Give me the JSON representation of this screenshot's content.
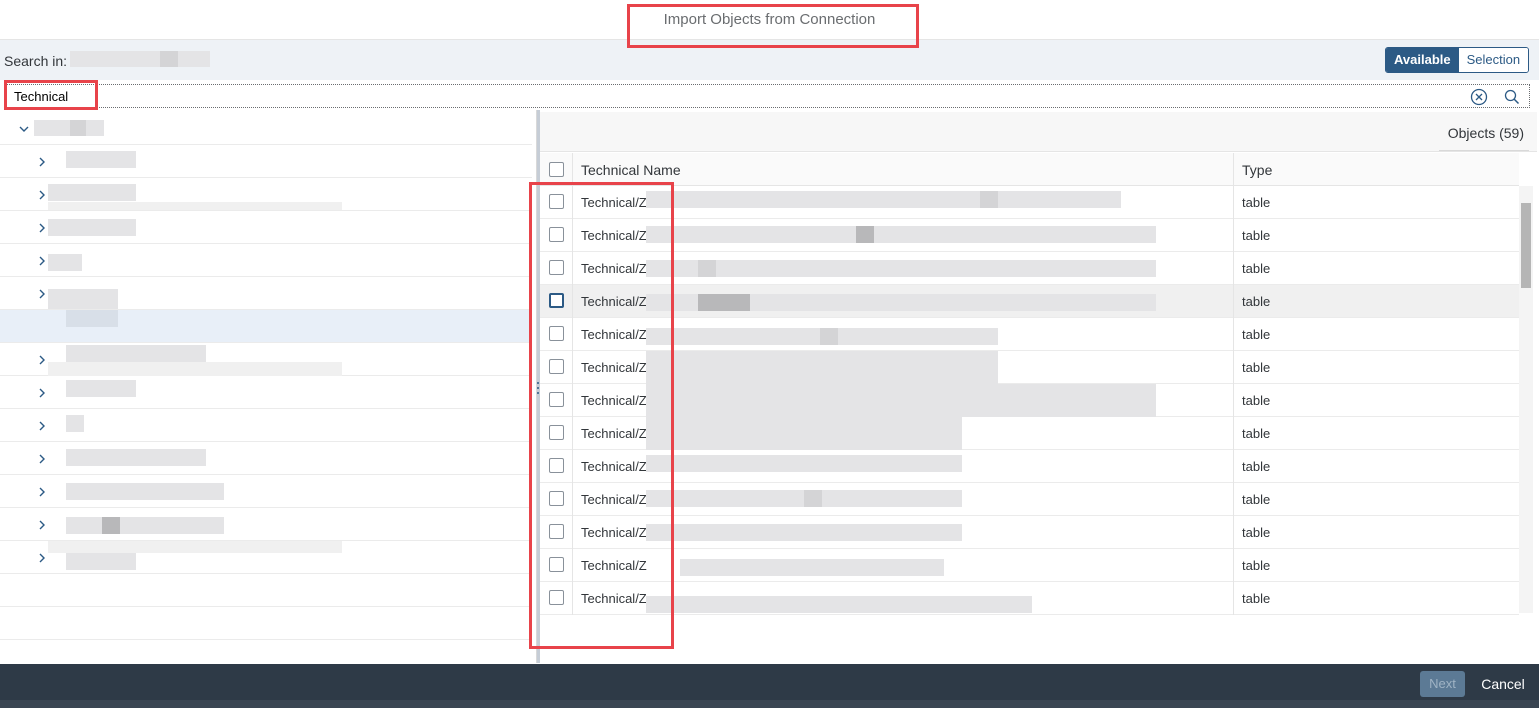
{
  "dialog": {
    "title": "Import Objects from Connection"
  },
  "search": {
    "label": "Search in:",
    "value": "Technical"
  },
  "view_toggle": {
    "available_label": "Available",
    "selection_label": "Selection",
    "active": "Available"
  },
  "objects_panel": {
    "count_label": "Objects (59)"
  },
  "table": {
    "columns": [
      "Technical Name",
      "Type"
    ],
    "rows": [
      {
        "name": "Technical/Z",
        "type": "table"
      },
      {
        "name": "Technical/Z",
        "type": "table"
      },
      {
        "name": "Technical/Z",
        "type": "table"
      },
      {
        "name": "Technical/Z",
        "type": "table"
      },
      {
        "name": "Technical/Z",
        "type": "table"
      },
      {
        "name": "Technical/Z",
        "type": "table"
      },
      {
        "name": "Technical/Z",
        "type": "table"
      },
      {
        "name": "Technical/Z",
        "type": "table"
      },
      {
        "name": "Technical/Z",
        "type": "table"
      },
      {
        "name": "Technical/Z",
        "type": "table"
      },
      {
        "name": "Technical/Z",
        "type": "table"
      },
      {
        "name": "Technical/Z",
        "type": "table"
      },
      {
        "name": "Technical/Z",
        "type": "table"
      }
    ]
  },
  "footer": {
    "next_label": "Next",
    "cancel_label": "Cancel"
  },
  "colors": {
    "accent": "#2c5a85",
    "highlight": "#e8434a",
    "footer_bg": "#2e3a47"
  },
  "icons": {
    "clear": "clear-circle-icon",
    "search": "search-icon",
    "expand": "chevron-right-icon",
    "collapse": "chevron-down-icon"
  }
}
